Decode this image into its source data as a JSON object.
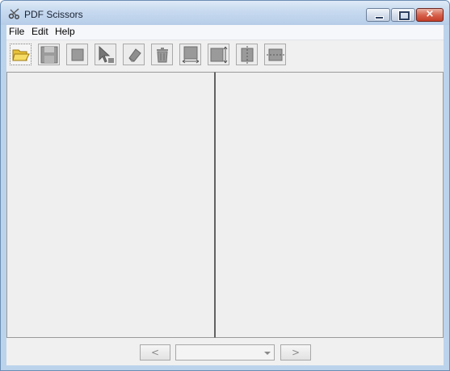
{
  "window": {
    "title": "PDF Scissors",
    "controls": {
      "minimize": "minimize-icon",
      "maximize": "maximize-icon",
      "close": "×"
    }
  },
  "menu": {
    "items": [
      {
        "label": "File"
      },
      {
        "label": "Edit"
      },
      {
        "label": "Help"
      }
    ]
  },
  "toolbar": {
    "buttons": [
      {
        "icon": "open-folder-icon"
      },
      {
        "icon": "save-icon"
      },
      {
        "icon": "crop-area-icon"
      },
      {
        "icon": "select-pointer-icon"
      },
      {
        "icon": "eraser-icon"
      },
      {
        "icon": "trash-icon"
      },
      {
        "icon": "equal-width-icon"
      },
      {
        "icon": "equal-height-icon"
      },
      {
        "icon": "split-vertical-icon"
      },
      {
        "icon": "split-horizontal-icon"
      }
    ]
  },
  "navigation": {
    "prev_label": "<",
    "next_label": ">",
    "page_value": ""
  }
}
